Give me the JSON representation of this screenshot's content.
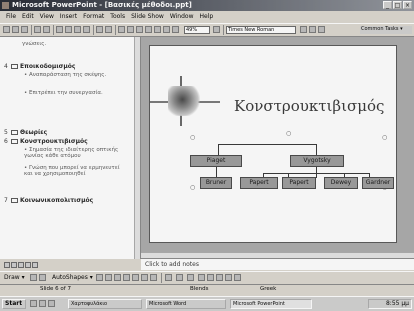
{
  "window": {
    "title": "Microsoft PowerPoint - [Βασικές μέθοδοι.ppt]"
  },
  "menu": [
    "File",
    "Edit",
    "View",
    "Insert",
    "Format",
    "Tools",
    "Slide Show",
    "Window",
    "Help"
  ],
  "toolbar": {
    "zoom": "49%",
    "font": "Times New Roman",
    "common_tasks": "Common Tasks ▾"
  },
  "outline": {
    "top_fragment": "γνώσεις.",
    "items": [
      {
        "num": "4",
        "title": "Εποικοδομισμός",
        "bullets": [
          "• Αναπαράσταση της σκέψης.",
          "• Επιτρέπει την συνεργασία."
        ]
      },
      {
        "num": "5",
        "title": "Θεωρίες",
        "bullets": []
      },
      {
        "num": "6",
        "title": "Κονστρουκτιβισμός",
        "bullets": [
          "• Σημασία της ιδιαίτερης οπτικής γωνίας κάθε ατόμου",
          "• Γνώση που μπορεί να ερμηνευτεί και να χρησιμοποιηθεί"
        ]
      },
      {
        "num": "7",
        "title": "Κοινωνικοπολιτισμός",
        "bullets": []
      }
    ]
  },
  "slide": {
    "title": "Κονστρουκτιβισμός",
    "org_top": [
      "Piaget",
      "Vygotsky"
    ],
    "org_bottom": [
      "Bruner",
      "Papert",
      "Papert",
      "Dewey",
      "Gardner"
    ]
  },
  "notes_placeholder": "Click to add notes",
  "drawbar": {
    "draw": "Draw ▾",
    "autoshapes": "AutoShapes ▾"
  },
  "status": {
    "slide": "Slide 6 of 7",
    "design": "Blends",
    "lang": "Greek"
  },
  "taskbar": {
    "start": "Start",
    "items": [
      "Χαρτοφυλάκιο",
      "Microsoft Word",
      "Microsoft PowerPoint"
    ],
    "clock": "8:55 μμ"
  }
}
